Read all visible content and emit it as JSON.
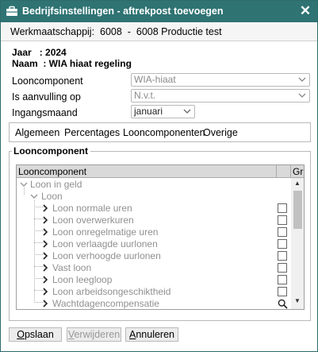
{
  "window": {
    "title": "Bedrijfsinstellingen - aftrekpost toevoegen",
    "close_glyph": "✕",
    "colors": {
      "titlebar": "#2f7373",
      "window_border": "#2f6b6b"
    }
  },
  "company": {
    "text": "Werkmaatschappij:  6008  -  6008 Productie test"
  },
  "info": {
    "year_line": "Jaar   : 2024",
    "name_line": "Naam  : WIA hiaat regeling"
  },
  "form": {
    "looncomponent": {
      "label": "Looncomponent",
      "value": "WIA-hiaat"
    },
    "aanvulling": {
      "label": "Is aanvulling op",
      "value": "N.v.t."
    },
    "ingangsmaand": {
      "label": "Ingangsmaand",
      "value": "januari"
    }
  },
  "tabs": [
    "Algemeen",
    "Percentages",
    "Looncomponenten",
    "Overige"
  ],
  "group": {
    "legend": "Looncomponent"
  },
  "tree": {
    "header": {
      "name_col": "Looncomponent",
      "second_col": "Gr"
    },
    "rows": [
      {
        "label": "Loon in geld",
        "level": 0,
        "expanded": true
      },
      {
        "label": "Loon",
        "level": 1,
        "expanded": true
      },
      {
        "label": "Loon normale uren",
        "level": 2,
        "expanded": false,
        "checked": false
      },
      {
        "label": "Loon overwerkuren",
        "level": 2,
        "expanded": false,
        "checked": false
      },
      {
        "label": "Loon onregelmatige uren",
        "level": 2,
        "expanded": false,
        "checked": false
      },
      {
        "label": "Loon verlaagde uurlonen",
        "level": 2,
        "expanded": false,
        "checked": false
      },
      {
        "label": "Loon verhoogde uurlonen",
        "level": 2,
        "expanded": false,
        "checked": false
      },
      {
        "label": "Vast loon",
        "level": 2,
        "expanded": false,
        "checked": false
      },
      {
        "label": "Loon leegloop",
        "level": 2,
        "expanded": false,
        "checked": false
      },
      {
        "label": "Loon arbeidsongeschiktheid",
        "level": 2,
        "expanded": false,
        "checked": false
      },
      {
        "label": "Wachtdagencompensatie",
        "level": 2,
        "expanded": false,
        "checked": false,
        "search_icon": true
      }
    ]
  },
  "buttons": {
    "opslaan": {
      "first": "O",
      "rest": "pslaan"
    },
    "verwijderen": {
      "first": "V",
      "rest": "erwijderen"
    },
    "annuleren": {
      "first": "A",
      "rest": "nnuleren"
    }
  },
  "icons": [
    "briefcase-icon",
    "close-icon",
    "chevron-down-icon",
    "expand-arrow-icon",
    "collapse-arrow-icon",
    "search-icon",
    "scroll-up-icon",
    "scroll-down-icon"
  ]
}
